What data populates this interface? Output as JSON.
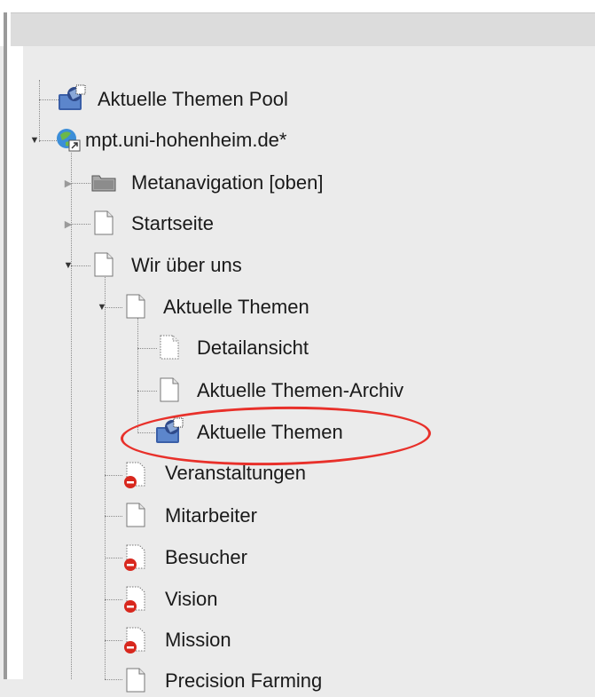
{
  "tree": {
    "items": [
      {
        "label": "Aktuelle Themen Pool",
        "icon": "folder-globe-icon"
      },
      {
        "label": "mpt.uni-hohenheim.de*",
        "icon": "globe-link-icon",
        "expanded": true
      },
      {
        "label": "Metanavigation [oben]",
        "icon": "folder-icon",
        "expanded": false
      },
      {
        "label": "Startseite",
        "icon": "page-icon",
        "expanded": false
      },
      {
        "label": "Wir über uns",
        "icon": "page-icon",
        "expanded": true
      },
      {
        "label": "Aktuelle Themen",
        "icon": "page-icon",
        "expanded": true
      },
      {
        "label": "Detailansicht",
        "icon": "page-dotted-icon"
      },
      {
        "label": "Aktuelle Themen-Archiv",
        "icon": "page-icon"
      },
      {
        "label": "Aktuelle Themen",
        "icon": "folder-globe-icon",
        "highlighted": true
      },
      {
        "label": "Veranstaltungen",
        "icon": "page-hidden-icon"
      },
      {
        "label": "Mitarbeiter",
        "icon": "page-icon"
      },
      {
        "label": "Besucher",
        "icon": "page-hidden-icon"
      },
      {
        "label": "Vision",
        "icon": "page-hidden-icon"
      },
      {
        "label": "Mission",
        "icon": "page-hidden-icon"
      },
      {
        "label": "Precision Farming",
        "icon": "page-icon"
      }
    ]
  },
  "colors": {
    "background": "#ebebeb",
    "highlight_ring": "#e8302a",
    "tree_lines": "#8a8a8a"
  }
}
